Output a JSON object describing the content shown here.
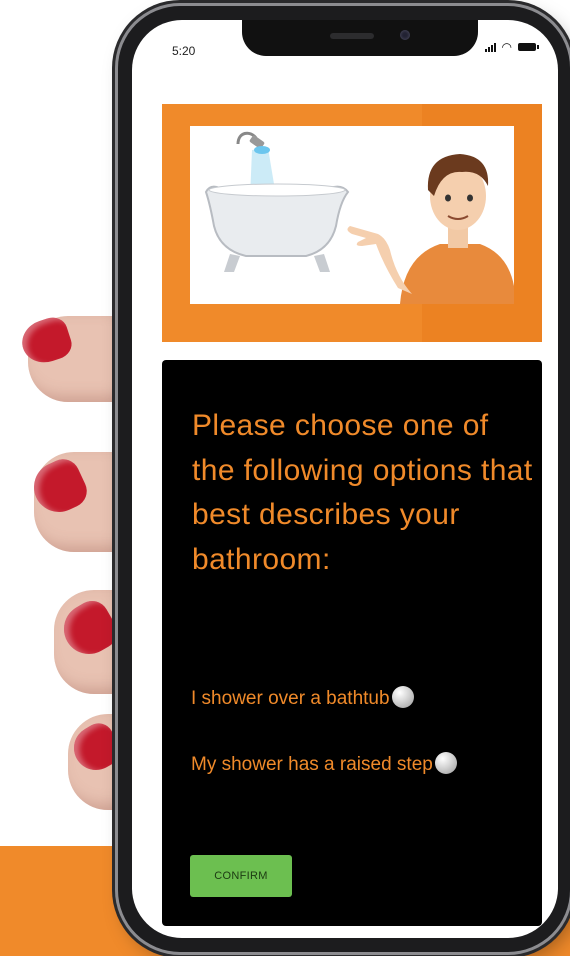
{
  "status_bar": {
    "time": "5:20"
  },
  "hero": {
    "illustration": "bathtub-with-shower-and-man-icon"
  },
  "question": {
    "text": "Please choose one of the following options that best describes your bathroom:"
  },
  "options": [
    {
      "label": "I shower over a bathtub",
      "selected": false
    },
    {
      "label": "My shower has a raised step",
      "selected": false
    }
  ],
  "confirm": {
    "label": "CONFIRM"
  },
  "colors": {
    "accent": "#f08a2a",
    "card": "#000000",
    "button": "#6cbf50"
  }
}
